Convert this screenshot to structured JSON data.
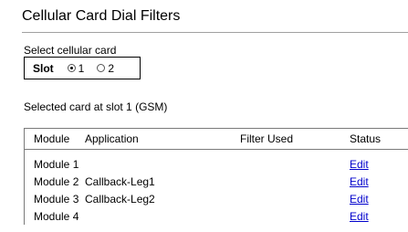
{
  "page": {
    "title": "Cellular Card Dial Filters"
  },
  "card_select": {
    "label": "Select cellular card",
    "slot_label": "Slot",
    "options": [
      {
        "label": "1",
        "checked": true
      },
      {
        "label": "2",
        "checked": false
      }
    ]
  },
  "selected_info": "Selected card at slot 1 (GSM)",
  "table": {
    "headers": {
      "module": "Module",
      "application": "Application",
      "filter_used": "Filter Used",
      "status": "Status"
    },
    "rows": [
      {
        "module": "Module 1",
        "application": "",
        "filter_used": "",
        "status": "Edit"
      },
      {
        "module": "Module 2",
        "application": "Callback-Leg1",
        "filter_used": "",
        "status": "Edit"
      },
      {
        "module": "Module 3",
        "application": "Callback-Leg2",
        "filter_used": "",
        "status": "Edit"
      },
      {
        "module": "Module 4",
        "application": "",
        "filter_used": "",
        "status": "Edit"
      }
    ]
  },
  "colors": {
    "link": "#0000cc",
    "rule": "#a0a0a0",
    "border": "#7a7a7a"
  }
}
